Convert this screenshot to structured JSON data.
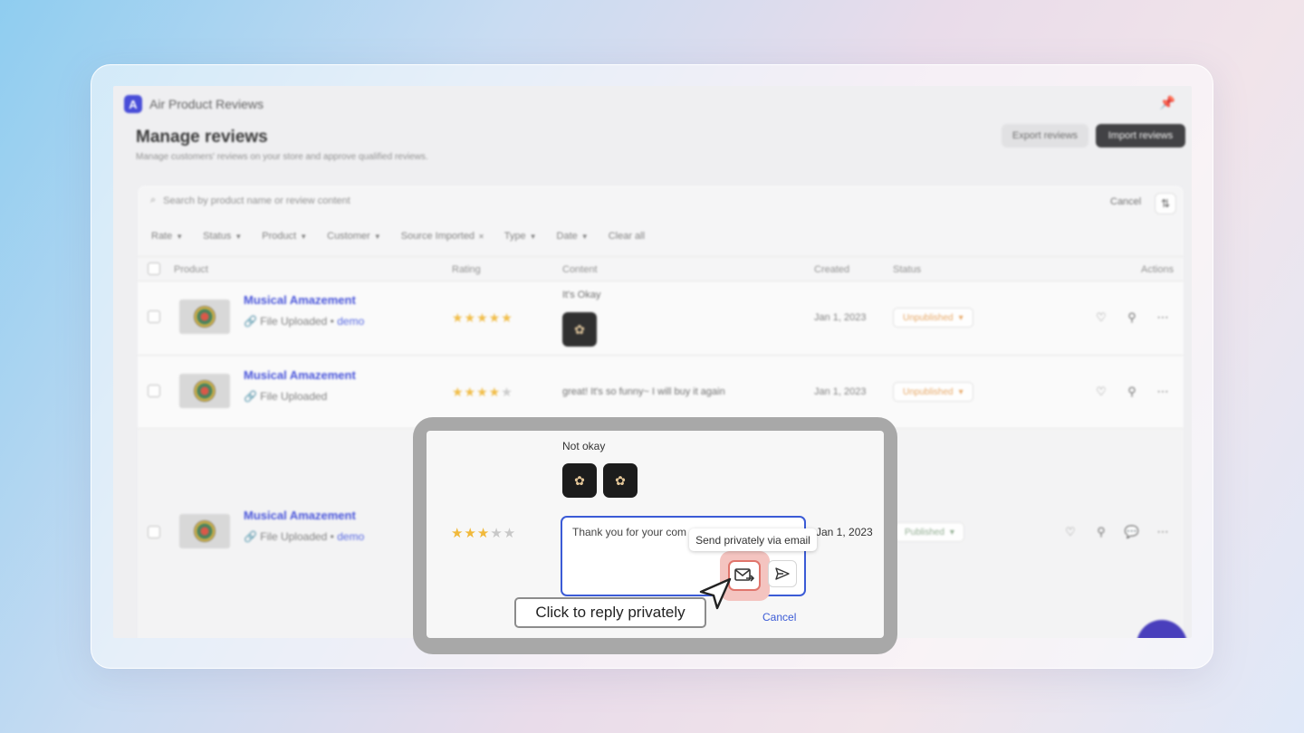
{
  "app": {
    "name": "Air Product Reviews",
    "logo_letter": "A",
    "title": "Manage reviews",
    "subtitle": "Manage customers' reviews on your store and approve qualified reviews.",
    "export_label": "Export reviews",
    "import_label": "Import reviews"
  },
  "search": {
    "placeholder": "Search by product name or review content",
    "cancel_label": "Cancel"
  },
  "filters": {
    "rate": "Rate",
    "status": "Status",
    "product": "Product",
    "customer": "Customer",
    "source": "Source Imported",
    "type": "Type",
    "date": "Date",
    "clear": "Clear all"
  },
  "table": {
    "headers": {
      "product": "Product",
      "rating": "Rating",
      "content": "Content",
      "created": "Created",
      "status": "Status",
      "actions": "Actions"
    },
    "rows": [
      {
        "product": "Musical Amazement",
        "source": "File Uploaded",
        "tag": "demo",
        "rating": 5,
        "content": "It's Okay",
        "created": "Jan 1, 2023",
        "status": "Unpublished"
      },
      {
        "product": "Musical Amazement",
        "source": "File Uploaded",
        "tag": "",
        "rating": 4,
        "content": "great! It's so funny~ I will buy it again",
        "created": "Jan 1, 2023",
        "status": "Unpublished"
      },
      {
        "product": "Musical Amazement",
        "source": "File Uploaded",
        "tag": "demo",
        "rating": 3,
        "content": "Not okay",
        "created": "Jan 1, 2023",
        "status": "Published"
      }
    ]
  },
  "highlight": {
    "content_text": "Not okay",
    "created": "Jan 1, 2023",
    "reply_text": "Thank you for your com",
    "tooltip": "Send privately via email",
    "cancel_label": "Cancel"
  },
  "callout": "Click to reply privately",
  "colors": {
    "accent": "#3b5bd6",
    "star": "#f1b93b",
    "focus_ring": "#e0756c",
    "unpublished": "#e8a35c"
  }
}
